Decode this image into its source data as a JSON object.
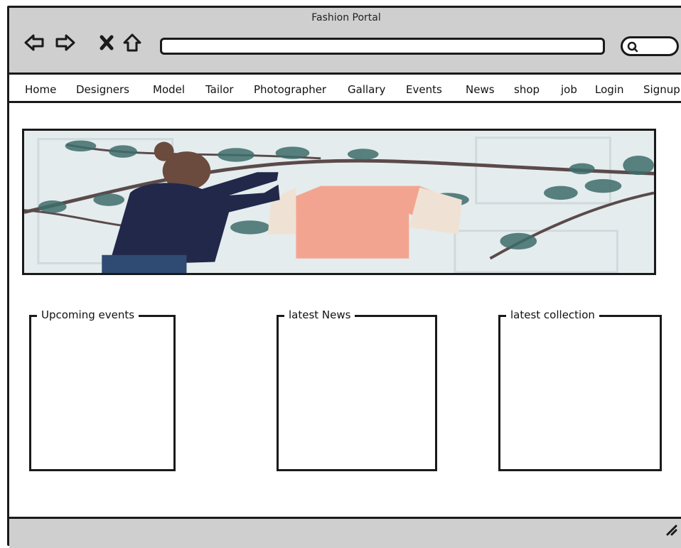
{
  "window": {
    "title": "Fashion Portal"
  },
  "toolbar": {
    "back_icon": "arrow-left-icon",
    "forward_icon": "arrow-right-icon",
    "stop_icon": "close-icon",
    "home_icon": "home-icon",
    "url_value": "",
    "search_icon": "search-icon"
  },
  "menu": {
    "items": [
      "Home",
      "Designers",
      "Model",
      "Tailor",
      "Photographer",
      "Gallary",
      "Events",
      "News",
      "shop",
      "job",
      "Login",
      "Signup"
    ]
  },
  "hero": {
    "image": "woman-hanging-garment-on-branch-photo"
  },
  "panels": {
    "events": {
      "label": "Upcoming events"
    },
    "news": {
      "label": "latest News"
    },
    "collection": {
      "label": "latest collection"
    }
  },
  "colors": {
    "chrome": "#cfcfcf",
    "stroke": "#1a1a1a",
    "garment": "#f2a08c"
  }
}
